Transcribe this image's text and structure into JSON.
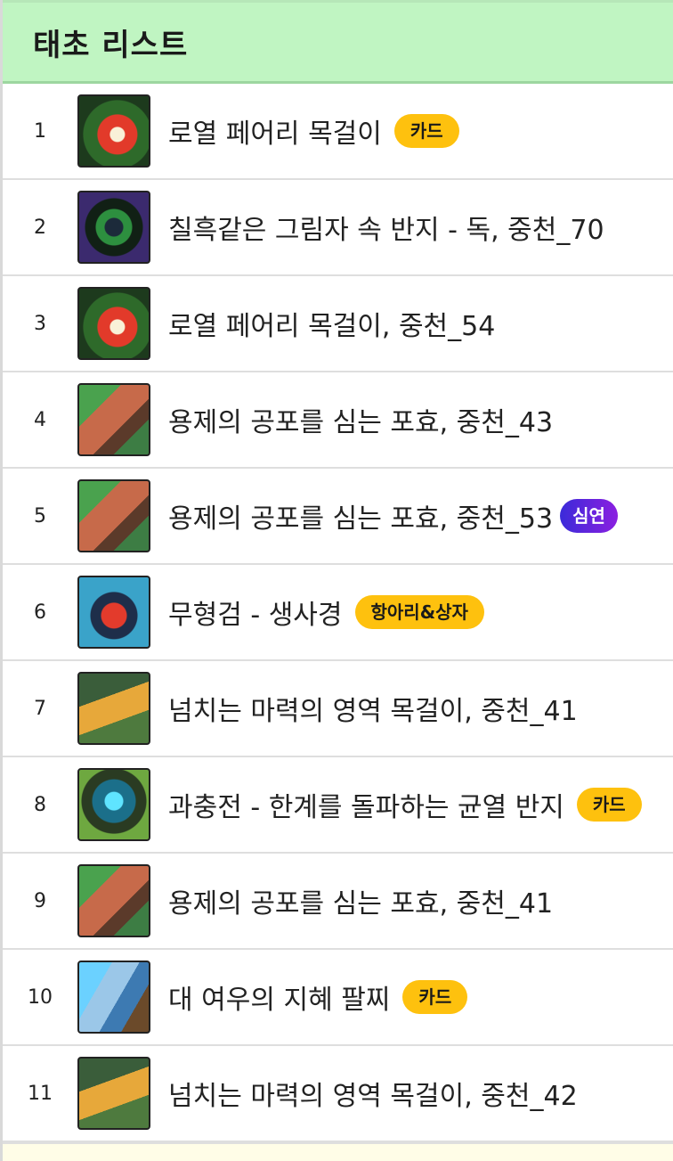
{
  "header": {
    "title": "태초 리스트"
  },
  "items": [
    {
      "num": "1",
      "name": "로열 페어리 목걸이",
      "badge": "카드",
      "badge_style": "yellow",
      "icon": "ic-flower"
    },
    {
      "num": "2",
      "name": "칠흑같은 그림자 속 반지 - 독, 중천_70",
      "badge": "",
      "badge_style": "",
      "icon": "ic-dark"
    },
    {
      "num": "3",
      "name": "로열 페어리 목걸이, 중천_54",
      "badge": "",
      "badge_style": "",
      "icon": "ic-flower"
    },
    {
      "num": "4",
      "name": "용제의 공포를 심는 포효, 중천_43",
      "badge": "",
      "badge_style": "",
      "icon": "ic-dragon"
    },
    {
      "num": "5",
      "name": "용제의 공포를 심는 포효, 중천_53",
      "badge": "심연",
      "badge_style": "purple",
      "icon": "ic-dragon"
    },
    {
      "num": "6",
      "name": "무형검 - 생사경",
      "badge": "항아리&상자",
      "badge_style": "yellow",
      "icon": "ic-sword"
    },
    {
      "num": "7",
      "name": "넘치는 마력의 영역 목걸이, 중천_41",
      "badge": "",
      "badge_style": "",
      "icon": "ic-mana"
    },
    {
      "num": "8",
      "name": "과충전 - 한계를 돌파하는 균열 반지",
      "badge": "카드",
      "badge_style": "yellow",
      "icon": "ic-crack"
    },
    {
      "num": "9",
      "name": "용제의 공포를 심는 포효, 중천_41",
      "badge": "",
      "badge_style": "",
      "icon": "ic-dragon"
    },
    {
      "num": "10",
      "name": "대 여우의 지혜 팔찌",
      "badge": "카드",
      "badge_style": "yellow",
      "icon": "ic-bracelet"
    },
    {
      "num": "11",
      "name": "넘치는 마력의 영역 목걸이, 중천_42",
      "badge": "",
      "badge_style": "",
      "icon": "ic-mana"
    }
  ],
  "colors": {
    "header_bg": "#c0f5c2",
    "badge_yellow": "#fec10e",
    "badge_purple": "#6a24dd",
    "footer_bg": "#fffde7"
  }
}
